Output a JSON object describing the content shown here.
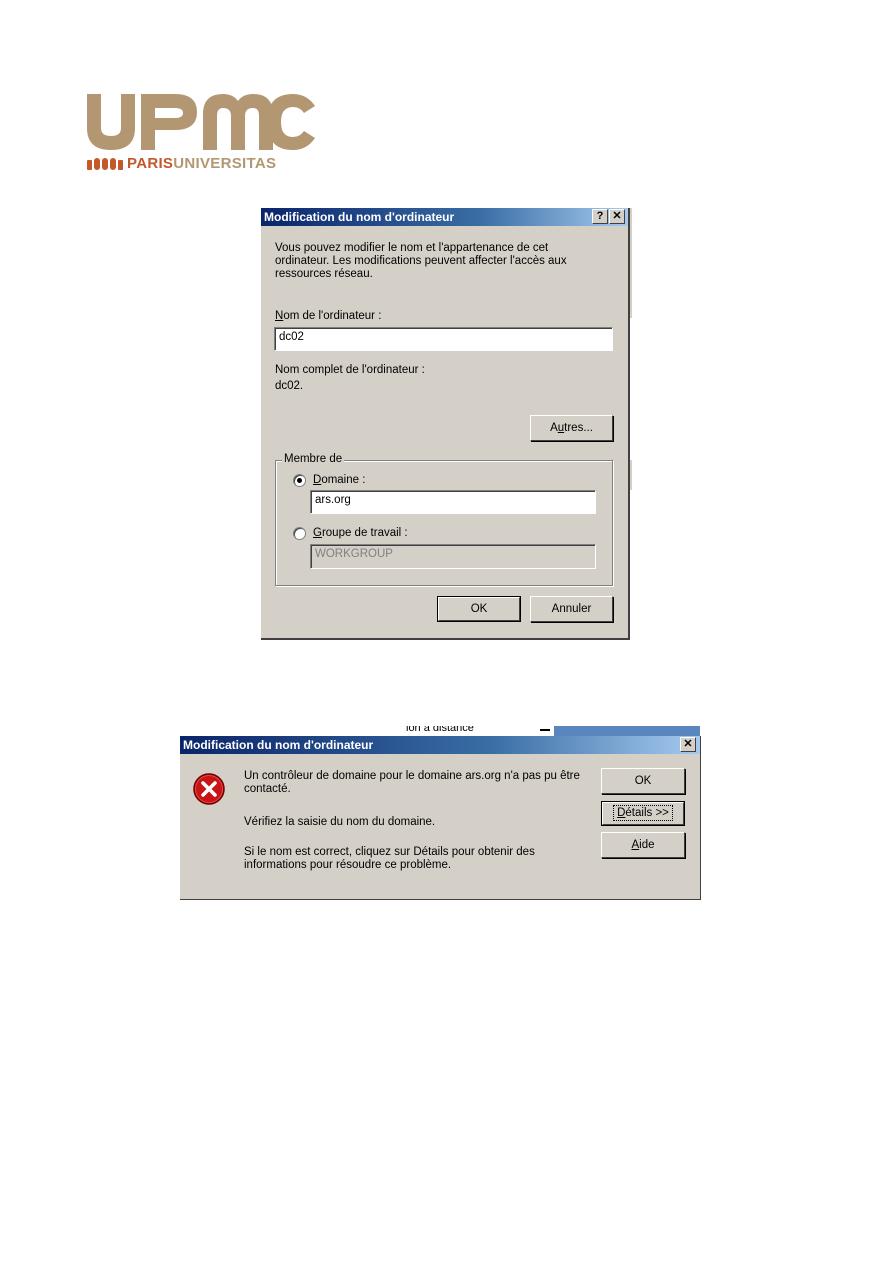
{
  "logo": {
    "wordmark": "UPMC",
    "tagline_part1": "PARIS",
    "tagline_part2": "UNIVERSITAS",
    "colors": {
      "wordmark": "#b29772",
      "accent": "#c4582a",
      "tagline_dark": "#c4582a",
      "tagline_light": "#b29772"
    }
  },
  "dialog_rename": {
    "title": "Modification du nom d'ordinateur",
    "help_button": "?",
    "close_button": "✕",
    "intro": "Vous pouvez modifier le nom et l'appartenance de cet\nordinateur. Les modifications peuvent affecter l'accès aux\nressources réseau.",
    "computer_name_label_first": "N",
    "computer_name_label_rest": "om de l'ordinateur :",
    "computer_name_value": "dc02",
    "full_name_label": "Nom complet de l'ordinateur :",
    "full_name_value": "dc02.",
    "more_button_a": "A",
    "more_button_u": "u",
    "more_button_rest": "tres...",
    "member_of_label": "Membre de",
    "domain_label_first": "D",
    "domain_label_rest": "omaine :",
    "domain_value": "ars.org",
    "domain_selected": true,
    "workgroup_label_first": "G",
    "workgroup_label_rest": "roupe de travail :",
    "workgroup_value": "WORKGROUP",
    "ok_button": "OK",
    "cancel_button": "Annuler"
  },
  "dialog_error": {
    "behind_text": "ion à distance",
    "title": "Modification du nom d'ordinateur",
    "close_button": "✕",
    "icon": "error-icon",
    "message_line1": "Un contrôleur de domaine pour le domaine ars.org n'a pas pu être\ncontacté.",
    "message_line2": "Vérifiez la saisie du nom du domaine.",
    "message_line3": "Si le nom est correct, cliquez sur Détails pour obtenir des\ninformations pour résoudre ce problème.",
    "ok_button": "OK",
    "details_button_first": "D",
    "details_button_rest": "étails >>",
    "help_button_first": "A",
    "help_button_rest": "ide"
  }
}
